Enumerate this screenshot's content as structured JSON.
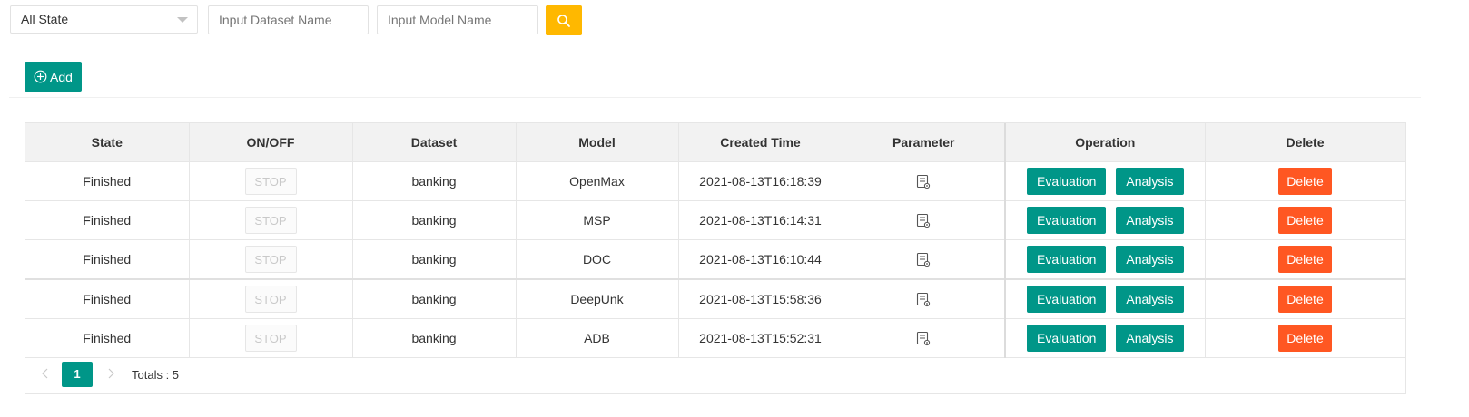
{
  "filters": {
    "state_select": "All State",
    "dataset_placeholder": "Input Dataset Name",
    "model_placeholder": "Input Model Name",
    "search_icon": "search-icon"
  },
  "toolbar": {
    "add_label": "Add",
    "add_icon": "plus-circle-icon"
  },
  "table": {
    "headers": [
      "State",
      "ON/OFF",
      "Dataset",
      "Model",
      "Created Time",
      "Parameter",
      "Operation",
      "Delete"
    ],
    "rows": [
      {
        "state": "Finished",
        "onoff": "STOP",
        "dataset": "banking",
        "model": "OpenMax",
        "created": "2021-08-13T16:18:39",
        "eval": "Evaluation",
        "analysis": "Analysis",
        "delete": "Delete"
      },
      {
        "state": "Finished",
        "onoff": "STOP",
        "dataset": "banking",
        "model": "MSP",
        "created": "2021-08-13T16:14:31",
        "eval": "Evaluation",
        "analysis": "Analysis",
        "delete": "Delete"
      },
      {
        "state": "Finished",
        "onoff": "STOP",
        "dataset": "banking",
        "model": "DOC",
        "created": "2021-08-13T16:10:44",
        "eval": "Evaluation",
        "analysis": "Analysis",
        "delete": "Delete"
      },
      {
        "state": "Finished",
        "onoff": "STOP",
        "dataset": "banking",
        "model": "DeepUnk",
        "created": "2021-08-13T15:58:36",
        "eval": "Evaluation",
        "analysis": "Analysis",
        "delete": "Delete"
      },
      {
        "state": "Finished",
        "onoff": "STOP",
        "dataset": "banking",
        "model": "ADB",
        "created": "2021-08-13T15:52:31",
        "eval": "Evaluation",
        "analysis": "Analysis",
        "delete": "Delete"
      }
    ]
  },
  "pagination": {
    "current_page": "1",
    "totals": "Totals : 5"
  },
  "colors": {
    "primary": "#009688",
    "warning": "#ffb800",
    "danger": "#ff5722"
  }
}
